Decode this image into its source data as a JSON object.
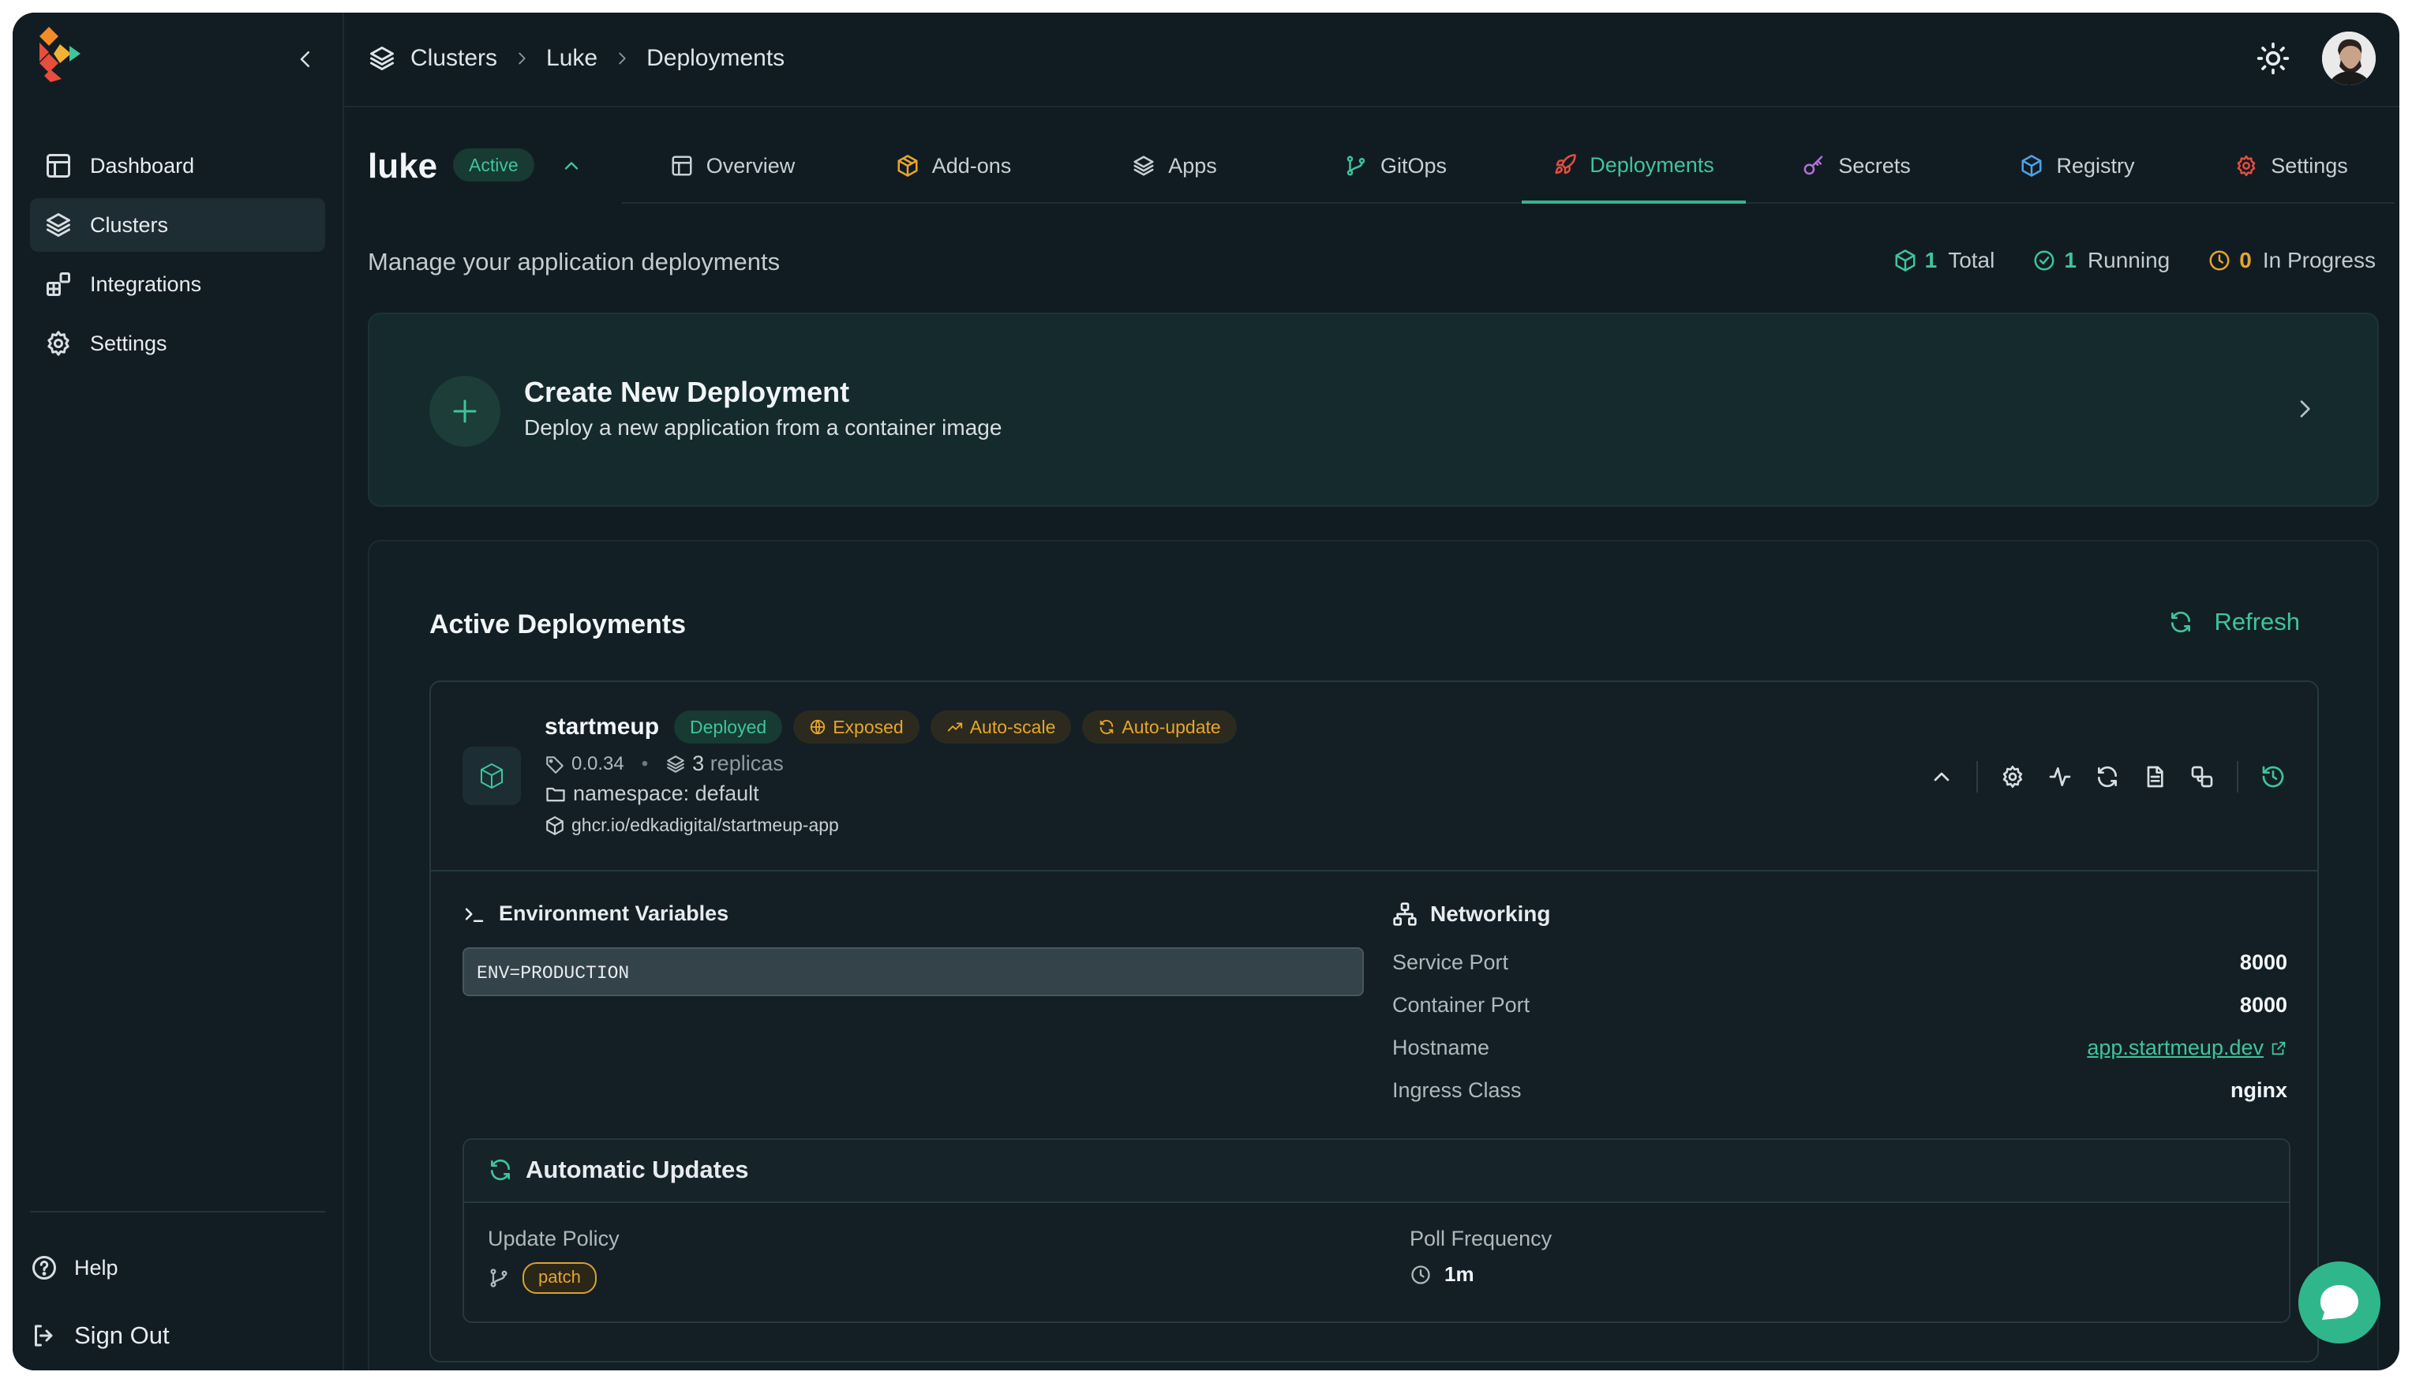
{
  "sidebar": {
    "items": [
      {
        "label": "Dashboard",
        "icon": "layout-icon"
      },
      {
        "label": "Clusters",
        "icon": "layers-icon",
        "active": true
      },
      {
        "label": "Integrations",
        "icon": "blocks-icon"
      },
      {
        "label": "Settings",
        "icon": "gear-icon"
      }
    ],
    "help_label": "Help",
    "signout_label": "Sign Out"
  },
  "breadcrumb": [
    "Clusters",
    "Luke",
    "Deployments"
  ],
  "cluster": {
    "name": "luke",
    "status": "Active"
  },
  "tabs": [
    {
      "label": "Overview",
      "icon": "layout-icon"
    },
    {
      "label": "Add-ons",
      "icon": "package-icon"
    },
    {
      "label": "Apps",
      "icon": "layers-icon"
    },
    {
      "label": "GitOps",
      "icon": "git-branch-icon"
    },
    {
      "label": "Deployments",
      "icon": "rocket-icon",
      "active": true
    },
    {
      "label": "Secrets",
      "icon": "key-icon"
    },
    {
      "label": "Registry",
      "icon": "box-icon"
    },
    {
      "label": "Settings",
      "icon": "gear-icon"
    }
  ],
  "page": {
    "subtitle": "Manage your application deployments"
  },
  "stats": {
    "total": {
      "value": "1",
      "label": "Total"
    },
    "running": {
      "value": "1",
      "label": "Running"
    },
    "in_progress": {
      "value": "0",
      "label": "In Progress"
    }
  },
  "create": {
    "title": "Create New Deployment",
    "desc": "Deploy a new application from a container image"
  },
  "active": {
    "title": "Active Deployments",
    "refresh_label": "Refresh"
  },
  "deployment": {
    "name": "startmeup",
    "badges": {
      "deployed": "Deployed",
      "exposed": "Exposed",
      "autoscale": "Auto-scale",
      "autoupdate": "Auto-update"
    },
    "version": "0.0.34",
    "replicas_count": "3",
    "replicas_label": "replicas",
    "namespace": "namespace: default",
    "image": "ghcr.io/edkadigital/startmeup-app",
    "env_title": "Environment Variables",
    "env_value": "ENV=PRODUCTION",
    "networking": {
      "title": "Networking",
      "rows": [
        {
          "key": "Service Port",
          "value": "8000"
        },
        {
          "key": "Container Port",
          "value": "8000"
        },
        {
          "key": "Hostname",
          "value": "app.startmeup.dev"
        },
        {
          "key": "Ingress Class",
          "value": "nginx"
        }
      ]
    },
    "auto_updates": {
      "title": "Automatic Updates",
      "policy_label": "Update Policy",
      "policy_value": "patch",
      "freq_label": "Poll Frequency",
      "freq_value": "1m"
    }
  },
  "colors": {
    "accent": "#3fc49b",
    "amber": "#e6a62c",
    "background": "#111c22"
  }
}
